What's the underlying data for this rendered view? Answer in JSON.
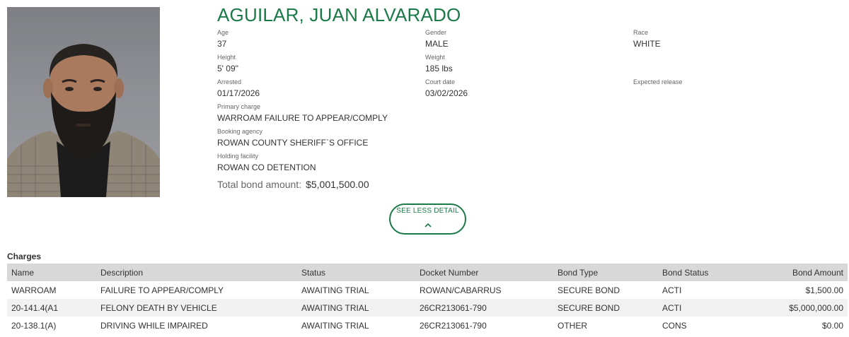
{
  "inmate": {
    "name": "AGUILAR, JUAN ALVARADO",
    "photo_icon": "mugshot-photo"
  },
  "details": {
    "age": {
      "label": "Age",
      "value": "37"
    },
    "gender": {
      "label": "Gender",
      "value": "MALE"
    },
    "race": {
      "label": "Race",
      "value": "WHITE"
    },
    "height": {
      "label": "Height",
      "value": "5' 09\""
    },
    "weight": {
      "label": "Weight",
      "value": "185 lbs"
    },
    "arrested": {
      "label": "Arrested",
      "value": "01/17/2026"
    },
    "court_date": {
      "label": "Court date",
      "value": "03/02/2026"
    },
    "expected_release": {
      "label": "Expected release",
      "value": ""
    },
    "primary_charge": {
      "label": "Primary charge",
      "value": "WARROAM FAILURE TO APPEAR/COMPLY"
    },
    "booking_agency": {
      "label": "Booking agency",
      "value": "ROWAN COUNTY SHERIFF`S OFFICE"
    },
    "holding_facility": {
      "label": "Holding facility",
      "value": "ROWAN CO DETENTION"
    },
    "total_bond": {
      "label": "Total bond amount:",
      "value": "$5,001,500.00"
    }
  },
  "toggle": {
    "label": "SEE LESS DETAIL",
    "icon": "chevron-up-icon"
  },
  "charges": {
    "title": "Charges",
    "columns": [
      "Name",
      "Description",
      "Status",
      "Docket Number",
      "Bond Type",
      "Bond Status",
      "Bond Amount"
    ],
    "rows": [
      [
        "WARROAM",
        "FAILURE TO APPEAR/COMPLY",
        "AWAITING TRIAL",
        "ROWAN/CABARRUS",
        "SECURE BOND",
        "ACTI",
        "$1,500.00"
      ],
      [
        "20-141.4(A1",
        "FELONY DEATH BY VEHICLE",
        "AWAITING TRIAL",
        "26CR213061-790",
        "SECURE BOND",
        "ACTI",
        "$5,000,000.00"
      ],
      [
        "20-138.1(A)",
        "DRIVING WHILE IMPAIRED",
        "AWAITING TRIAL",
        "26CR213061-790",
        "OTHER",
        "CONS",
        "$0.00"
      ]
    ]
  },
  "colors": {
    "accent": "#1a7a48",
    "table_header_bg": "#d8d8d8",
    "row_alt_bg": "#f1f1f1"
  }
}
